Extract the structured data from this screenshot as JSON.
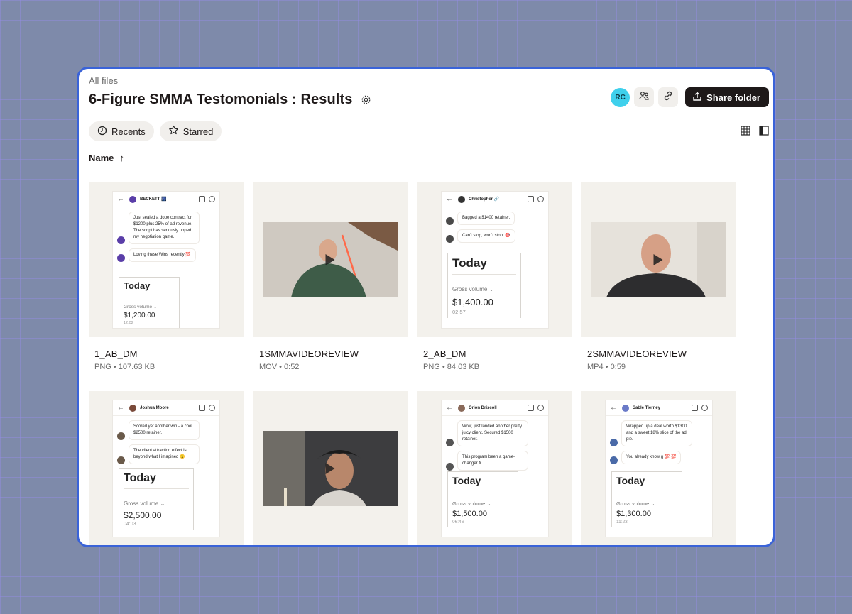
{
  "breadcrumb": "All files",
  "title": "6-Figure SMMA Testomonials : Results",
  "actions": {
    "avatar_initials": "RC",
    "share_label": "Share folder"
  },
  "filters": {
    "recents": "Recents",
    "starred": "Starred"
  },
  "sort": {
    "column": "Name",
    "arrow": "↑"
  },
  "files": [
    {
      "name": "1_AB_DM",
      "meta": "PNG • 107.63 KB",
      "kind": "chat",
      "contact": "BECKETT 🎆",
      "messages": [
        "Just sealed a dope contract for $1200 plus 25% of ad revenue. The script has seriously upped my negotiation game.",
        "Loving these Wins recently 💯"
      ],
      "today": "Today",
      "gross_label": "Gross volume ⌄",
      "amount": "$1,200.00",
      "time": "12:02"
    },
    {
      "name": "1SMMAVIDEOREVIEW",
      "meta": "MOV • 0:52",
      "kind": "video",
      "scene": "a"
    },
    {
      "name": "2_AB_DM",
      "meta": "PNG • 84.03 KB",
      "kind": "chat",
      "contact": "Christopher 🔗",
      "messages": [
        "Bagged a $1400 retainer.",
        "Can't stop, won't stop. 🎯"
      ],
      "today": "Today",
      "gross_label": "Gross volume ⌄",
      "amount": "$1,400.00",
      "time": "02:57"
    },
    {
      "name": "2SMMAVIDEOREVIEW",
      "meta": "MP4 • 0:59",
      "kind": "video",
      "scene": "b"
    },
    {
      "name": "",
      "meta": "",
      "kind": "chat",
      "contact": "Joshua Moore",
      "messages": [
        "Scored yet another win - a cool $2500 retainer.",
        "The client attraction effect is beyond what I imagined 😮"
      ],
      "today": "Today",
      "gross_label": "Gross volume ⌄",
      "amount": "$2,500.00",
      "time": "04:03"
    },
    {
      "name": "",
      "meta": "",
      "kind": "video",
      "scene": "c"
    },
    {
      "name": "",
      "meta": "",
      "kind": "chat",
      "contact": "Orion Driscoll",
      "messages": [
        "Wow, just landed another pretty juicy client. Secured $1500 retainer.",
        "This program been a game-changer fr"
      ],
      "today": "Today",
      "gross_label": "Gross volume ⌄",
      "amount": "$1,500.00",
      "time": "06:46"
    },
    {
      "name": "",
      "meta": "",
      "kind": "chat",
      "contact": "Sable Tierney",
      "messages": [
        "Wrapped up a deal worth $1300 and a sweet 18% slice of the ad pie.",
        "You already know g 💯 💯"
      ],
      "today": "Today",
      "gross_label": "Gross volume ⌄",
      "amount": "$1,300.00",
      "time": "11:23"
    }
  ],
  "colors": {
    "accent_border": "#3a63d8",
    "avatar_bg": "#3fd0ec",
    "primary_button": "#1e1919"
  }
}
